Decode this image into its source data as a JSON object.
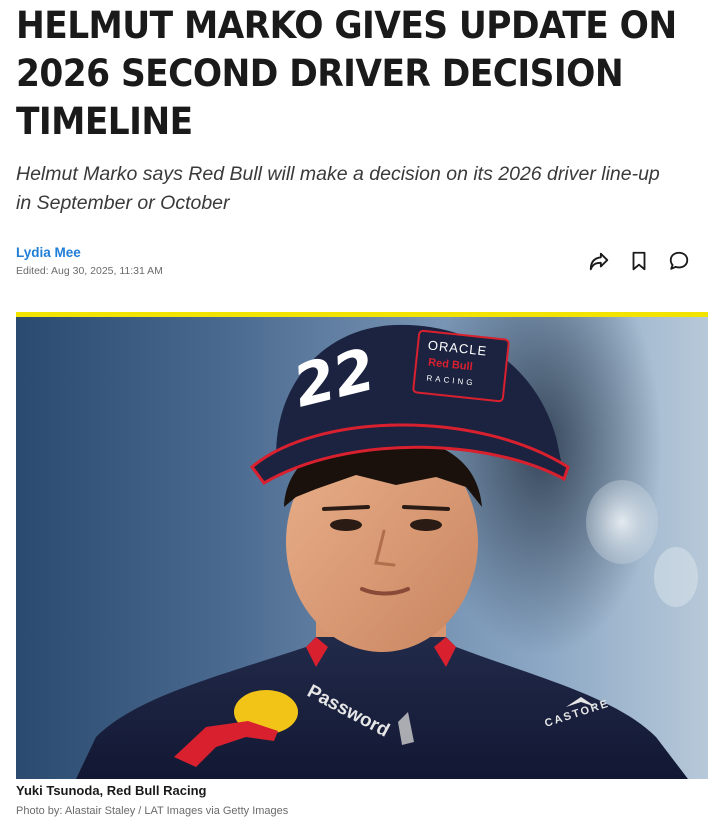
{
  "article": {
    "headline": "HELMUT MARKO GIVES UPDATE ON 2026 SECOND DRIVER DECISION TIMELINE",
    "subtitle": "Helmut Marko says Red Bull will make a decision on its 2026 driver line-up in September or October",
    "author": "Lydia Mee",
    "edited": "Edited: Aug 30, 2025, 11:31 AM"
  },
  "actions": [
    {
      "icon": "share-icon"
    },
    {
      "icon": "bookmark-icon"
    },
    {
      "icon": "comment-icon"
    }
  ],
  "image": {
    "cap_number": "22",
    "cap_sponsor_line1": "ORACLE",
    "cap_sponsor_line2": "Red Bull",
    "cap_sponsor_line3": "RACING",
    "shirt_text_left": "Password",
    "shirt_text_right": "CASTORE",
    "caption": "Yuki Tsunoda, Red Bull Racing",
    "credit": "Photo by: Alastair Staley / LAT Images via Getty Images"
  },
  "colors": {
    "accent_yellow": "#f2e400",
    "author_blue": "#1f7ed6",
    "cap_navy": "#1b2340",
    "cap_red": "#d8202e"
  }
}
